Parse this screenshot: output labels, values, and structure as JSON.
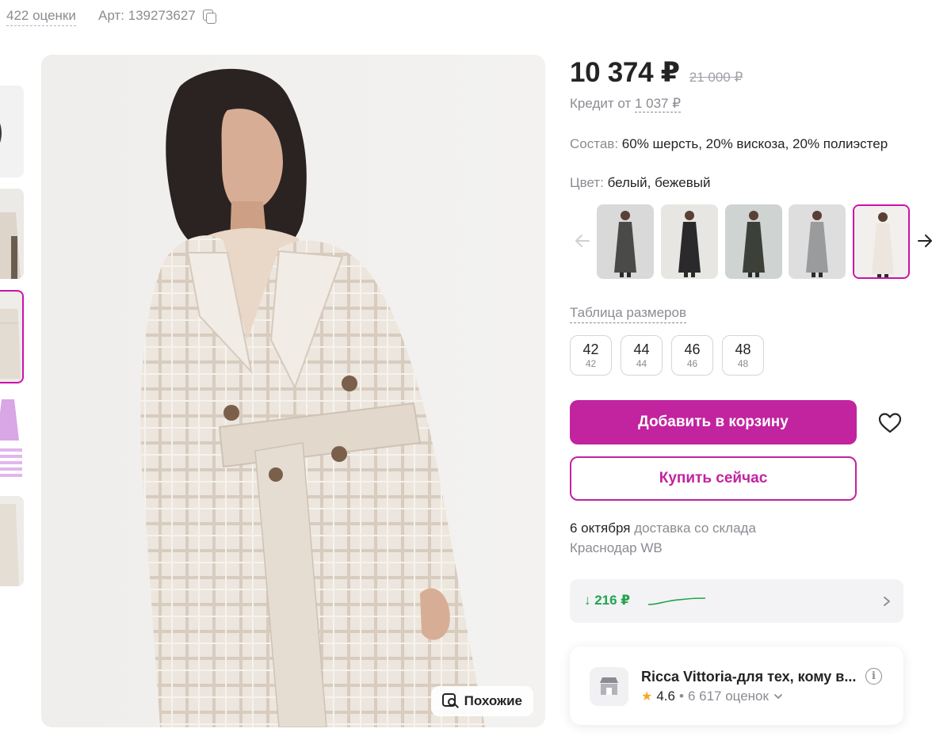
{
  "header": {
    "ratings_count": "422 оценки",
    "article": "Арт: 139273627"
  },
  "main_photo": {
    "similar_label": "Похожие"
  },
  "product": {
    "price": "10 374 ₽",
    "old_price": "21 000 ₽",
    "credit_prefix": "Кредит от",
    "credit_amount": "1 037 ₽",
    "composition_label": "Состав:",
    "composition_value": "60% шерсть, 20% вискоза, 20% полиэстер",
    "color_label": "Цвет:",
    "color_value": "белый, бежевый",
    "color_variants": [
      {
        "name": "dark-gray",
        "coat": "#4a4a48",
        "bg": "#d9d9d9"
      },
      {
        "name": "black",
        "coat": "#2a2a2c",
        "bg": "#e8e6e2"
      },
      {
        "name": "plaid",
        "coat": "#3c4038",
        "bg": "#cfd3d1"
      },
      {
        "name": "gray",
        "coat": "#9a9b9c",
        "bg": "#dedede"
      },
      {
        "name": "beige-white",
        "coat": "#ece6df",
        "bg": "#f2efec",
        "selected": true
      }
    ],
    "size_table_label": "Таблица размеров",
    "sizes": [
      {
        "size": "42",
        "ru": "42"
      },
      {
        "size": "44",
        "ru": "44"
      },
      {
        "size": "46",
        "ru": "46"
      },
      {
        "size": "48",
        "ru": "48"
      }
    ],
    "add_to_cart": "Добавить в корзину",
    "buy_now": "Купить сейчас",
    "delivery_date": "6 октября",
    "delivery_text": "доставка со склада",
    "delivery_warehouse": "Краснодар WB",
    "price_drop": "↓ 216 ₽"
  },
  "seller": {
    "name": "Ricca Vittoria-для тех, кому в...",
    "rating": "4.6",
    "reviews": "6 617 оценок"
  },
  "colors": {
    "accent": "#c2239f",
    "price_down": "#22a44e",
    "muted": "#8b8b93",
    "star": "#f5a623"
  }
}
